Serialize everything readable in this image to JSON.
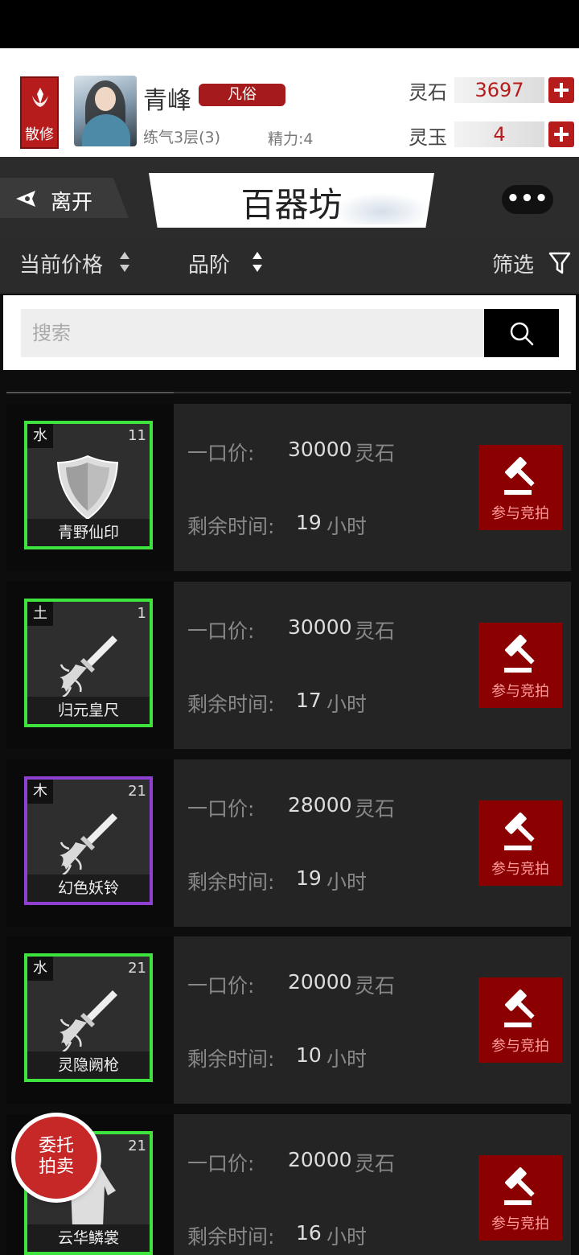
{
  "header": {
    "sect_label": "散修",
    "player_name": "青峰",
    "rank_tag": "凡俗",
    "realm": "练气3层(3)",
    "energy": "精力:4",
    "resources": [
      {
        "label": "灵石",
        "value": "3697"
      },
      {
        "label": "灵玉",
        "value": "4"
      }
    ]
  },
  "titlebar": {
    "leave_label": "离开",
    "title": "百器坊",
    "more_label": "•••"
  },
  "sortbar": {
    "price_label": "当前价格",
    "grade_label": "品阶",
    "filter_label": "筛选"
  },
  "search": {
    "placeholder": "搜索"
  },
  "labels": {
    "price_label": "一口价:",
    "price_unit": "灵石",
    "time_label": "剩余时间:",
    "time_unit": "小时",
    "bid_label": "参与竞拍"
  },
  "items": [
    {
      "element": "水",
      "level": "11",
      "name": "青野仙印",
      "price": "30000",
      "hours": "19",
      "quality_color": "#3ee33e",
      "icon": "shield-icon"
    },
    {
      "element": "土",
      "level": "1",
      "name": "归元皇尺",
      "price": "30000",
      "hours": "17",
      "quality_color": "#3ee33e",
      "icon": "sword-icon"
    },
    {
      "element": "木",
      "level": "21",
      "name": "幻色妖铃",
      "price": "28000",
      "hours": "19",
      "quality_color": "#8f3fd2",
      "icon": "sword-icon"
    },
    {
      "element": "水",
      "level": "21",
      "name": "灵隐阙枪",
      "price": "20000",
      "hours": "10",
      "quality_color": "#3ee33e",
      "icon": "sword-icon"
    },
    {
      "element": "",
      "level": "21",
      "name": "云华鳞裳",
      "price": "20000",
      "hours": "16",
      "quality_color": "#3ee33e",
      "icon": "robe-icon"
    }
  ],
  "float_button": {
    "line1": "委托",
    "line2": "拍卖"
  },
  "colors": {
    "accent_red": "#b71c1c",
    "bid_red": "#8b0000",
    "green_quality": "#3ee33e",
    "purple_quality": "#8f3fd2"
  }
}
